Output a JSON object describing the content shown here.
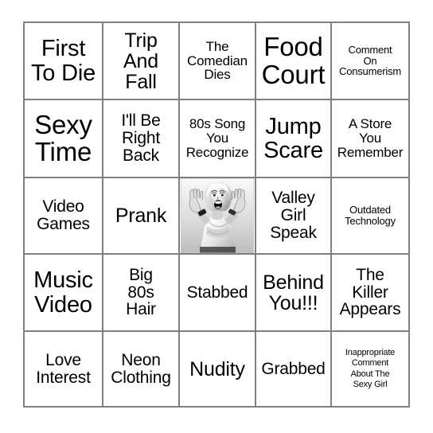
{
  "card": {
    "title": "Bingo Card",
    "grid_size": "5x5",
    "border_color": "#808080",
    "background_color": "#ffffff",
    "text_color": "#000000",
    "rows": [
      [
        {
          "label": "First\nTo Die",
          "size": "xl",
          "type": "text"
        },
        {
          "label": "Trip\nAnd\nFall",
          "size": "lg",
          "type": "text"
        },
        {
          "label": "The\nComedian\nDies",
          "size": "sm",
          "type": "text"
        },
        {
          "label": "Food\nCourt",
          "size": "xxl",
          "type": "text"
        },
        {
          "label": "Comment\nOn\nConsumerism",
          "size": "xs",
          "type": "text"
        }
      ],
      [
        {
          "label": "Sexy\nTime",
          "size": "xxl",
          "type": "text"
        },
        {
          "label": "I'll Be\nRight\nBack",
          "size": "md",
          "type": "text"
        },
        {
          "label": "80s Song\nYou\nRecognize",
          "size": "sm",
          "type": "text"
        },
        {
          "label": "Jump\nScare",
          "size": "xl",
          "type": "text"
        },
        {
          "label": "A Store\nYou\nRemember",
          "size": "sm",
          "type": "text"
        }
      ],
      [
        {
          "label": "Video\nGames",
          "size": "md",
          "type": "text"
        },
        {
          "label": "Prank",
          "size": "lg",
          "type": "text"
        },
        {
          "label": "",
          "size": "md",
          "type": "image",
          "image_name": "screaming-woman-photo",
          "image_alt": "Black and white photo of a screaming woman with raised hands"
        },
        {
          "label": "Valley\nGirl\nSpeak",
          "size": "md",
          "type": "text"
        },
        {
          "label": "Outdated\nTechnology",
          "size": "xs",
          "type": "text"
        }
      ],
      [
        {
          "label": "Music\nVideo",
          "size": "xl",
          "type": "text"
        },
        {
          "label": "Big\n80s\nHair",
          "size": "md",
          "type": "text"
        },
        {
          "label": "Stabbed",
          "size": "md",
          "type": "text"
        },
        {
          "label": "Behind\nYou!!!",
          "size": "lg",
          "type": "text"
        },
        {
          "label": "The\nKiller\nAppears",
          "size": "md",
          "type": "text"
        }
      ],
      [
        {
          "label": "Love\nInterest",
          "size": "md",
          "type": "text"
        },
        {
          "label": "Neon\nClothing",
          "size": "md",
          "type": "text"
        },
        {
          "label": "Nudity",
          "size": "lg",
          "type": "text"
        },
        {
          "label": "Grabbed",
          "size": "md",
          "type": "text"
        },
        {
          "label": "Inappropriate\nComment\nAbout The\nSexy Girl",
          "size": "xxs",
          "type": "text"
        }
      ]
    ]
  }
}
